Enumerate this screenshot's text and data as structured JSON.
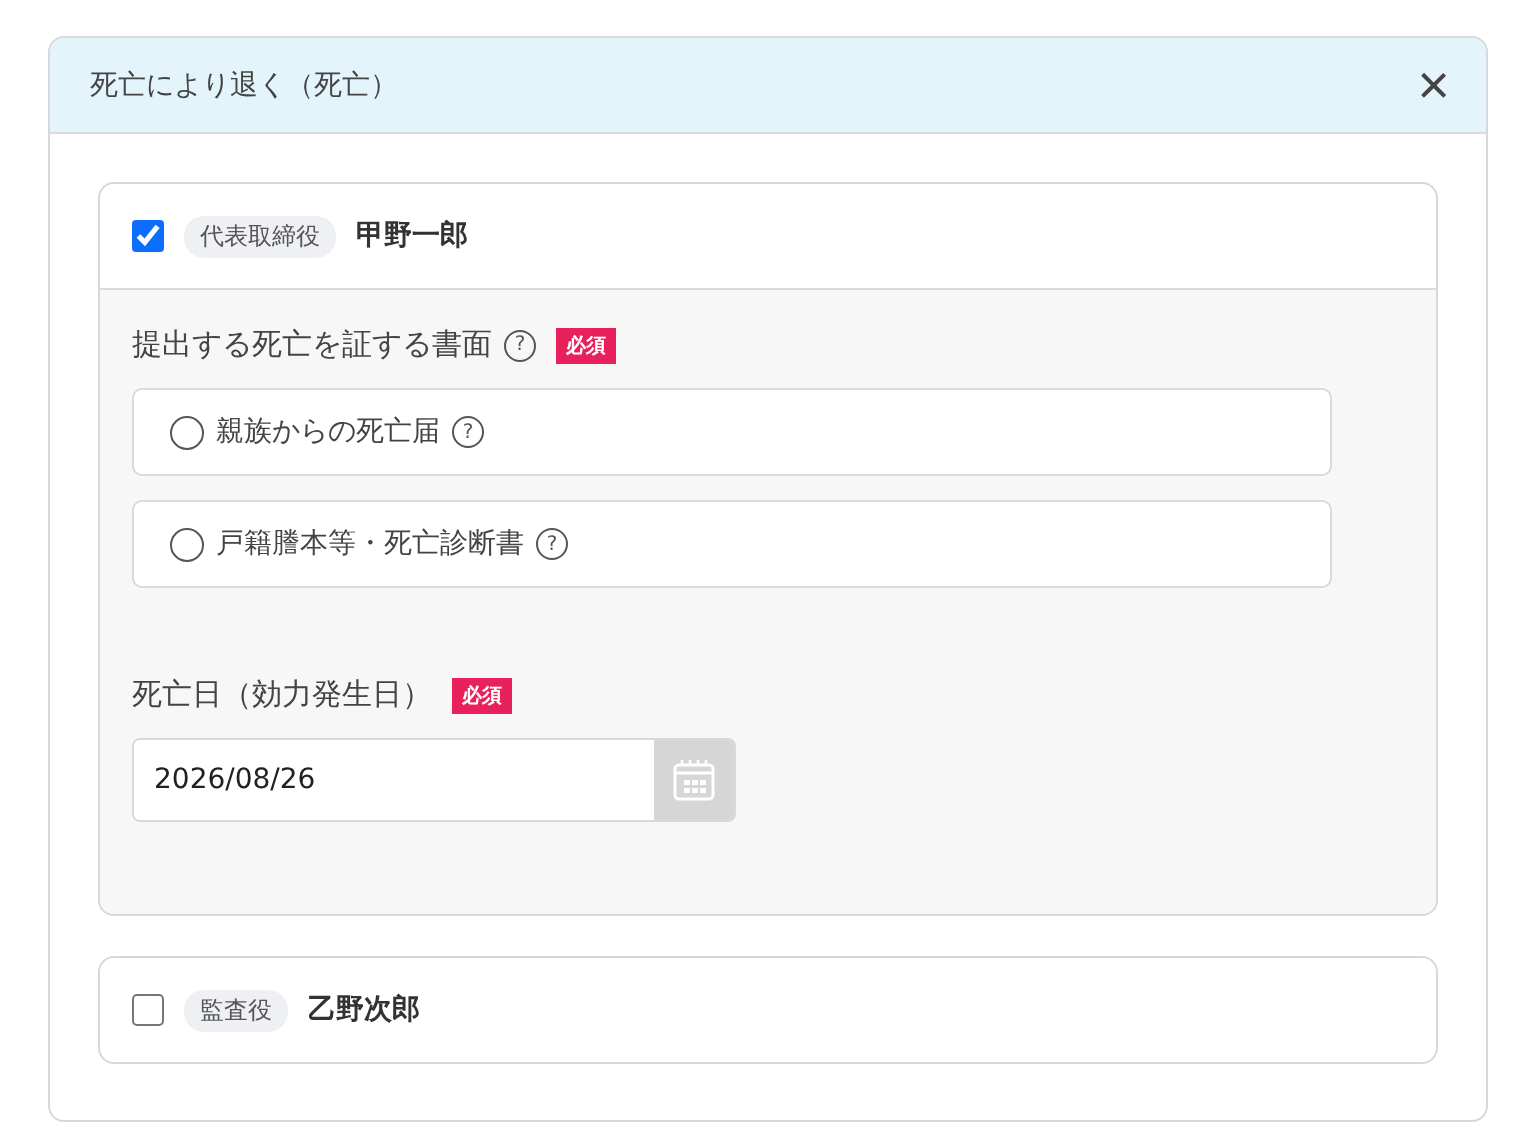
{
  "dialog": {
    "title": "死亡により退く（死亡）",
    "close": "×"
  },
  "officers": [
    {
      "checked": true,
      "role": "代表取締役",
      "name": "甲野一郎",
      "form": {
        "document": {
          "label": "提出する死亡を証する書面",
          "help": "?",
          "required": "必須",
          "options": [
            {
              "label": "親族からの死亡届",
              "help": "?",
              "selected": false
            },
            {
              "label": "戸籍謄本等・死亡診断書",
              "help": "?",
              "selected": false
            }
          ]
        },
        "date": {
          "label": "死亡日（効力発生日）",
          "required": "必須",
          "value": "2026/08/26"
        }
      }
    },
    {
      "checked": false,
      "role": "監査役",
      "name": "乙野次郎"
    }
  ]
}
